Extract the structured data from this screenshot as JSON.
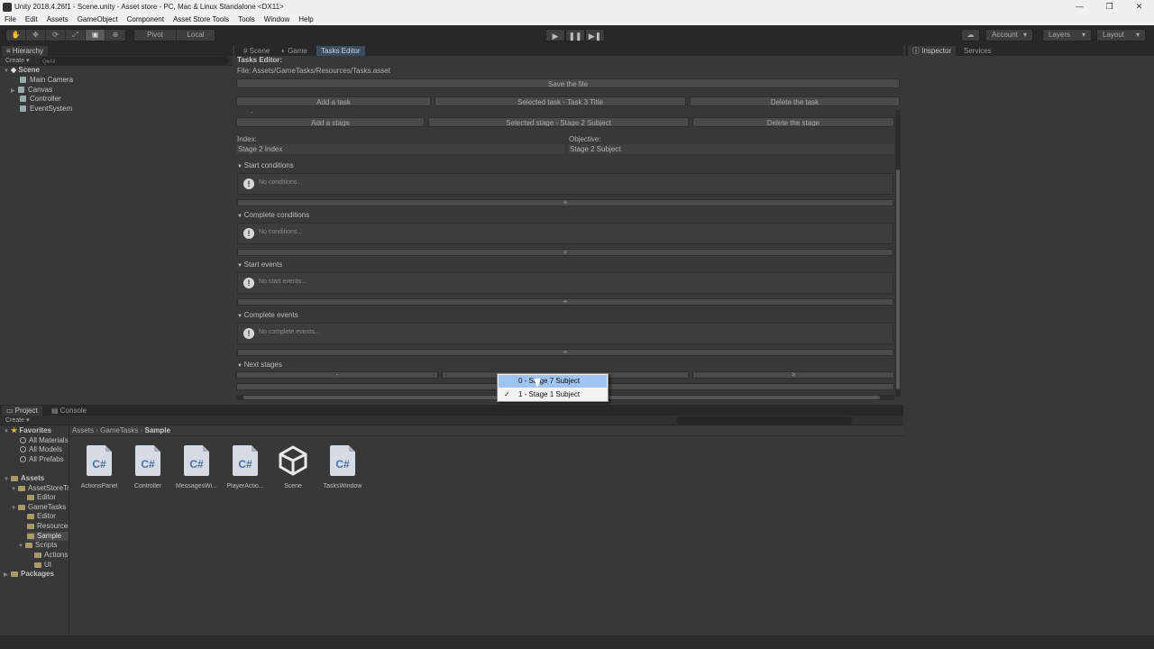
{
  "window": {
    "title": "Unity 2018.4.26f1 - Scene.unity - Asset store - PC, Mac & Linux Standalone <DX11>",
    "controls": [
      "—",
      "❐",
      "✕"
    ]
  },
  "menu": [
    "File",
    "Edit",
    "Assets",
    "GameObject",
    "Component",
    "Asset Store Tools",
    "Tools",
    "Window",
    "Help"
  ],
  "toolbar": {
    "tools": [
      "✋",
      "✥",
      "⟳",
      "⤢",
      "▣",
      "⊕"
    ],
    "pivot": "Pivot",
    "local": "Local",
    "play": "▶",
    "pause": "❚❚",
    "step": "▶❚",
    "cloud": "☁",
    "account": "Account",
    "layers": "Layers",
    "layout": "Layout"
  },
  "hierarchy": {
    "tab": "Hierarchy",
    "create": "Create ▾",
    "search_placeholder": "Q▾All",
    "scene": "Scene",
    "items": [
      "Main Camera",
      "Canvas",
      "Controller",
      "EventSystem"
    ]
  },
  "center_tabs": [
    "Scene",
    "Game",
    "Tasks Editor"
  ],
  "tasks": {
    "heading": "Tasks Editor:",
    "file": "File: Assets/GameTasks/Resources/Tasks.asset",
    "save": "Save the file",
    "add_task": "Add a task",
    "selected_task": "Selected task - Task 3 Title",
    "delete_task": "Delete the task",
    "add_stage": "Add a stage",
    "selected_stage": "Selected stage - Stage 2 Subject",
    "delete_stage": "Delete the stage",
    "index_label": "Index:",
    "index_value": "Stage 2 Index",
    "objective_label": "Objective:",
    "objective_value": "Stage 2 Subject",
    "sections": [
      {
        "title": "Start conditions",
        "msg": "No conditions..."
      },
      {
        "title": "Complete conditions",
        "msg": "No conditions..."
      },
      {
        "title": "Start events",
        "msg": "No start events..."
      },
      {
        "title": "Complete events",
        "msg": "No complete events..."
      }
    ],
    "plus": "+",
    "next_stages": "Next stages",
    "minus": "-",
    "next_btn": ">",
    "popup": [
      "0 - Stage 7 Subject",
      "1 - Stage 1 Subject"
    ],
    "check": "✓"
  },
  "inspector": {
    "tabs": [
      "Inspector",
      "Services"
    ]
  },
  "project": {
    "tabs": [
      "Project",
      "Console"
    ],
    "create": "Create ▾",
    "breadcrumb": [
      "Assets",
      "GameTasks",
      "Sample"
    ],
    "favorites": "Favorites",
    "fav_items": [
      "All Materials",
      "All Models",
      "All Prefabs"
    ],
    "assets_root": "Assets",
    "tree": [
      {
        "label": "AssetStoreTools",
        "indent": 1
      },
      {
        "label": "Editor",
        "indent": 2
      },
      {
        "label": "GameTasks",
        "indent": 1
      },
      {
        "label": "Editor",
        "indent": 2
      },
      {
        "label": "Resources",
        "indent": 2
      },
      {
        "label": "Sample",
        "indent": 2
      },
      {
        "label": "Scripts",
        "indent": 2
      },
      {
        "label": "Actions",
        "indent": 3
      },
      {
        "label": "UI",
        "indent": 3
      }
    ],
    "packages": "Packages",
    "files": [
      {
        "name": "ActionsPanel",
        "kind": "C#"
      },
      {
        "name": "Controller",
        "kind": "C#"
      },
      {
        "name": "MessagesWi...",
        "kind": "C#"
      },
      {
        "name": "PlayerActio...",
        "kind": "C#"
      },
      {
        "name": "Scene",
        "kind": "unity"
      },
      {
        "name": "TasksWindow",
        "kind": "C#"
      }
    ]
  }
}
